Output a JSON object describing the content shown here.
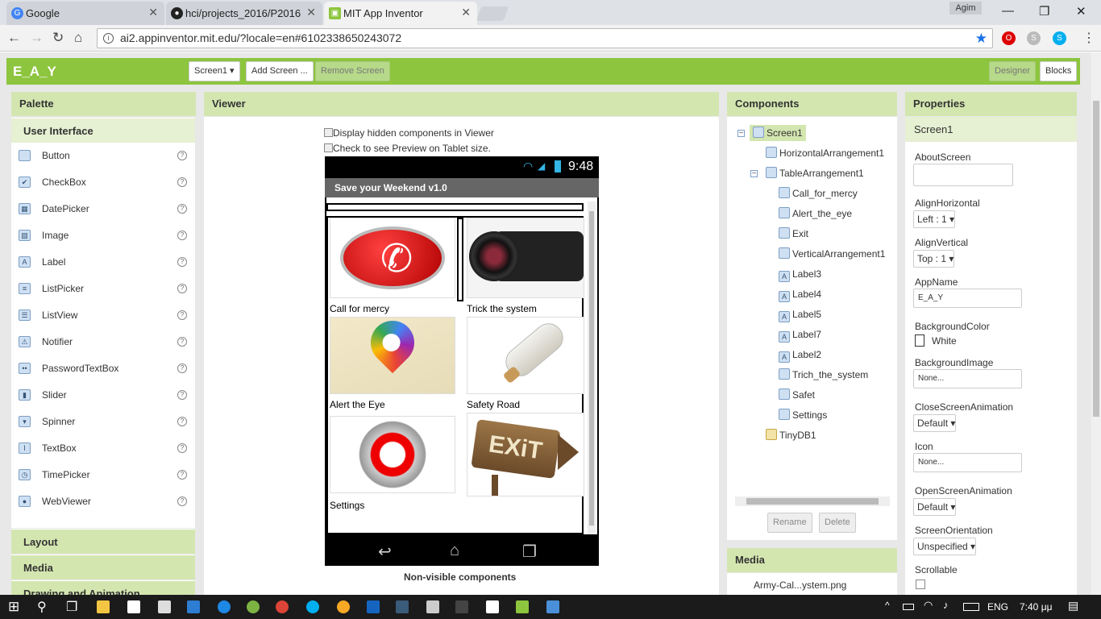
{
  "browser": {
    "tabs": [
      {
        "title": "Google",
        "active": false
      },
      {
        "title": "hci/projects_2016/P2016",
        "active": false
      },
      {
        "title": "MIT App Inventor",
        "active": true
      }
    ],
    "profile": "Agim",
    "url": "ai2.appinventor.mit.edu/?locale=en#6102338650243072"
  },
  "app": {
    "project_name": "E_A_Y",
    "screen_selector": "Screen1 ▾",
    "add_screen": "Add Screen ...",
    "remove_screen": "Remove Screen",
    "designer": "Designer",
    "blocks": "Blocks"
  },
  "palette": {
    "title": "Palette",
    "category_open": "User Interface",
    "items": [
      "Button",
      "CheckBox",
      "DatePicker",
      "Image",
      "Label",
      "ListPicker",
      "ListView",
      "Notifier",
      "PasswordTextBox",
      "Slider",
      "Spinner",
      "TextBox",
      "TimePicker",
      "WebViewer"
    ],
    "help_glyph": "?",
    "categories_closed": [
      "Layout",
      "Media",
      "Drawing and Animation"
    ]
  },
  "viewer": {
    "title": "Viewer",
    "check_hidden": "Display hidden components in Viewer",
    "check_tablet": "Check to see Preview on Tablet size.",
    "time": "9:48",
    "app_title": "Save your Weekend v1.0",
    "cells": [
      "Call for mercy",
      "Trick the system",
      "Alert the Eye",
      "Safety Road",
      "Settings"
    ],
    "exit_text": "EXiT",
    "non_visible": "Non-visible components"
  },
  "components": {
    "title": "Components",
    "tree": [
      {
        "name": "Screen1",
        "level": 0
      },
      {
        "name": "HorizontalArrangement1",
        "level": 1
      },
      {
        "name": "TableArrangement1",
        "level": 1
      },
      {
        "name": "Call_for_mercy",
        "level": 2
      },
      {
        "name": "Alert_the_eye",
        "level": 2
      },
      {
        "name": "Exit",
        "level": 2
      },
      {
        "name": "VerticalArrangement1",
        "level": 2
      },
      {
        "name": "Label3",
        "level": 2
      },
      {
        "name": "Label4",
        "level": 2
      },
      {
        "name": "Label5",
        "level": 2
      },
      {
        "name": "Label7",
        "level": 2
      },
      {
        "name": "Label2",
        "level": 2
      },
      {
        "name": "Trich_the_system",
        "level": 2
      },
      {
        "name": "Safet",
        "level": 2
      },
      {
        "name": "Settings",
        "level": 2
      },
      {
        "name": "TinyDB1",
        "level": 1
      }
    ],
    "rename": "Rename",
    "delete": "Delete",
    "media_title": "Media",
    "media_file": "Army-Cal...ystem.png"
  },
  "properties": {
    "title": "Properties",
    "component": "Screen1",
    "about_screen": "AboutScreen",
    "align_h_label": "AlignHorizontal",
    "align_h_value": "Left : 1 ▾",
    "align_v_label": "AlignVertical",
    "align_v_value": "Top : 1 ▾",
    "app_name_label": "AppName",
    "app_name_value": "E_A_Y",
    "bg_color_label": "BackgroundColor",
    "bg_color_value": "White",
    "bg_image_label": "BackgroundImage",
    "bg_image_value": "None...",
    "close_anim_label": "CloseScreenAnimation",
    "close_anim_value": "Default ▾",
    "icon_label": "Icon",
    "icon_value": "None...",
    "open_anim_label": "OpenScreenAnimation",
    "open_anim_value": "Default ▾",
    "orientation_label": "ScreenOrientation",
    "orientation_value": "Unspecified ▾",
    "scrollable_label": "Scrollable"
  },
  "taskbar": {
    "language": "ENG",
    "time": "7:40 μμ"
  },
  "colors": {
    "accent_green": "#8dc53e",
    "panel_head": "#d4e6b0"
  }
}
